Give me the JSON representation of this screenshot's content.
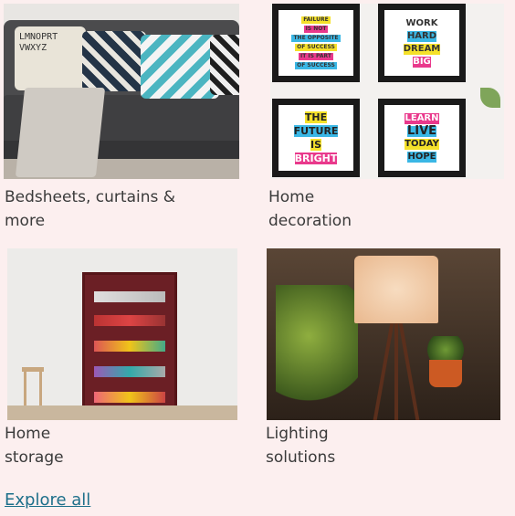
{
  "categories": [
    {
      "label": "Bedsheets, curtains & more",
      "image": {
        "pillow_text": "LMNOPRT VWXYZ",
        "colors": {
          "sofa": "#4b4b4d",
          "pillow_teal": "#4bb5c1",
          "pillow_navy": "#243447"
        }
      }
    },
    {
      "label": "Home decoration",
      "image": {
        "frames": [
          {
            "lines": [
              "FAILURE",
              "IS NOT",
              "THE OPPOSITE",
              "OF SUCCESS",
              "IT IS PART",
              "OF SUCCESS"
            ]
          },
          {
            "lines": [
              "WORK",
              "HARD",
              "DREAM",
              "BIG"
            ]
          },
          {
            "lines": [
              "THE",
              "FUTURE",
              "IS",
              "BRIGHT"
            ]
          },
          {
            "lines": [
              "LEARN",
              "LIVE",
              "TODAY",
              "HOPE"
            ]
          }
        ]
      }
    },
    {
      "label": "Home storage"
    },
    {
      "label": "Lighting solutions"
    }
  ],
  "explore_all": "Explore all",
  "colors": {
    "background": "#fcefef",
    "link": "#1d6f8a"
  }
}
